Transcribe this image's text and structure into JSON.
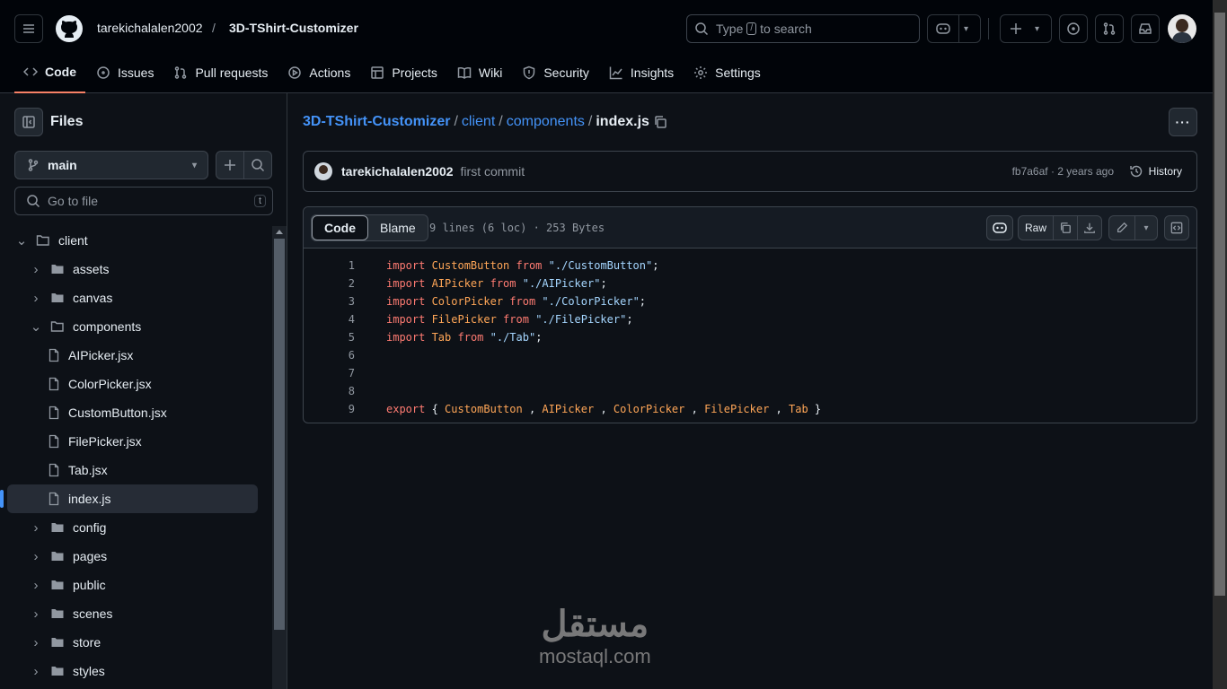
{
  "header": {
    "owner": "tarekichalalen2002",
    "separator": "/",
    "repo": "3D-TShirt-Customizer",
    "search": {
      "prefix": "Type",
      "key": "/",
      "suffix": "to search"
    }
  },
  "tabs": [
    {
      "label": "Code",
      "icon": "code-icon"
    },
    {
      "label": "Issues",
      "icon": "issue-icon"
    },
    {
      "label": "Pull requests",
      "icon": "pull-request-icon"
    },
    {
      "label": "Actions",
      "icon": "play-icon"
    },
    {
      "label": "Projects",
      "icon": "table-icon"
    },
    {
      "label": "Wiki",
      "icon": "book-icon"
    },
    {
      "label": "Security",
      "icon": "shield-icon"
    },
    {
      "label": "Insights",
      "icon": "graph-icon"
    },
    {
      "label": "Settings",
      "icon": "gear-icon"
    }
  ],
  "sidebar": {
    "title": "Files",
    "branch": "main",
    "goto_placeholder": "Go to file",
    "goto_key": "t",
    "tree": [
      {
        "label": "client",
        "type": "folder",
        "expanded": true
      },
      {
        "label": "assets",
        "type": "folder"
      },
      {
        "label": "canvas",
        "type": "folder"
      },
      {
        "label": "components",
        "type": "folder",
        "expanded": true
      },
      {
        "label": "AIPicker.jsx",
        "type": "file"
      },
      {
        "label": "ColorPicker.jsx",
        "type": "file"
      },
      {
        "label": "CustomButton.jsx",
        "type": "file"
      },
      {
        "label": "FilePicker.jsx",
        "type": "file"
      },
      {
        "label": "Tab.jsx",
        "type": "file"
      },
      {
        "label": "index.js",
        "type": "file",
        "selected": true
      },
      {
        "label": "config",
        "type": "folder"
      },
      {
        "label": "pages",
        "type": "folder"
      },
      {
        "label": "public",
        "type": "folder"
      },
      {
        "label": "scenes",
        "type": "folder"
      },
      {
        "label": "store",
        "type": "folder"
      },
      {
        "label": "styles",
        "type": "folder"
      }
    ]
  },
  "breadcrumb": {
    "repo": "3D-TShirt-Customizer",
    "p1": "client",
    "p2": "components",
    "file": "index.js",
    "sep": "/"
  },
  "commit": {
    "author": "tarekichalalen2002",
    "message": "first commit",
    "hash_time": "fb7a6af · 2 years ago",
    "history": "History"
  },
  "file": {
    "tab_code": "Code",
    "tab_blame": "Blame",
    "meta": "9 lines (6 loc) · 253 Bytes",
    "raw": "Raw",
    "lines": [
      [
        [
          "kw",
          "import "
        ],
        [
          "id",
          "CustomButton"
        ],
        [
          "kw",
          " from "
        ],
        [
          "str",
          "\"./CustomButton\""
        ],
        [
          "p",
          ";"
        ]
      ],
      [
        [
          "kw",
          "import "
        ],
        [
          "id",
          "AIPicker"
        ],
        [
          "kw",
          " from "
        ],
        [
          "str",
          "\"./AIPicker\""
        ],
        [
          "p",
          ";"
        ]
      ],
      [
        [
          "kw",
          "import "
        ],
        [
          "id",
          "ColorPicker"
        ],
        [
          "kw",
          " from "
        ],
        [
          "str",
          "\"./ColorPicker\""
        ],
        [
          "p",
          ";"
        ]
      ],
      [
        [
          "kw",
          "import "
        ],
        [
          "id",
          "FilePicker"
        ],
        [
          "kw",
          " from "
        ],
        [
          "str",
          "\"./FilePicker\""
        ],
        [
          "p",
          ";"
        ]
      ],
      [
        [
          "kw",
          "import "
        ],
        [
          "id",
          "Tab"
        ],
        [
          "kw",
          " from "
        ],
        [
          "str",
          "\"./Tab\""
        ],
        [
          "p",
          ";"
        ]
      ],
      [],
      [],
      [],
      [
        [
          "kw",
          "export "
        ],
        [
          "p",
          "{ "
        ],
        [
          "id",
          "CustomButton"
        ],
        [
          "p",
          " , "
        ],
        [
          "id",
          "AIPicker"
        ],
        [
          "p",
          " , "
        ],
        [
          "id",
          "ColorPicker"
        ],
        [
          "p",
          " , "
        ],
        [
          "id",
          "FilePicker"
        ],
        [
          "p",
          " , "
        ],
        [
          "id",
          "Tab"
        ],
        [
          "p",
          " }"
        ]
      ]
    ]
  },
  "watermark": {
    "arabic": "مستقل",
    "latin": "mostaql.com"
  }
}
